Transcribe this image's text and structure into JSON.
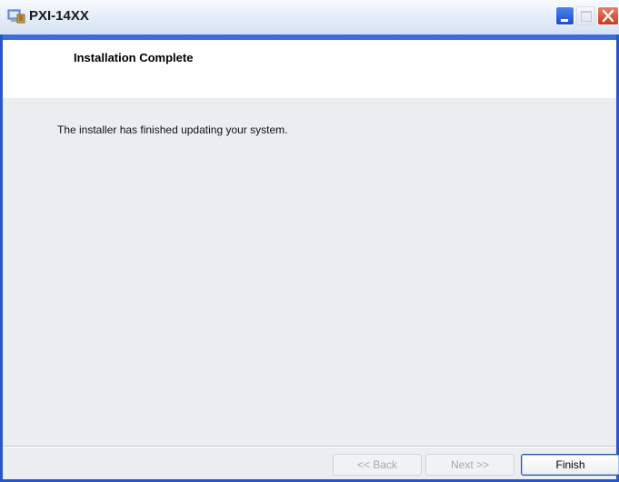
{
  "window": {
    "title": "PXI-14XX"
  },
  "header": {
    "title": "Installation Complete"
  },
  "main": {
    "message": "The installer has finished updating your system."
  },
  "buttons": {
    "back": "<< Back",
    "next": "Next >>",
    "finish": "Finish"
  },
  "icons": {
    "title": "installer-icon",
    "minimize": "minimize-icon",
    "maximize": "maximize-icon",
    "close": "close-icon"
  },
  "colors": {
    "titlebar_accent": "#3b6fe0",
    "close_button": "#d04a2c"
  }
}
